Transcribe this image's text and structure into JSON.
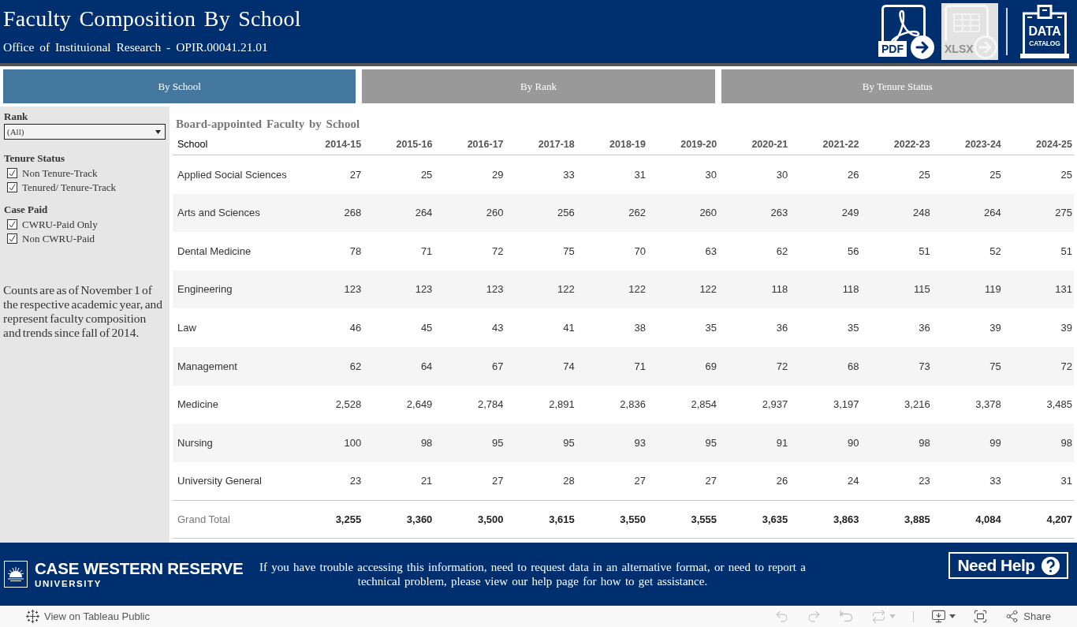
{
  "header": {
    "title": "Faculty Composition By School",
    "subtitle": "Office of Instituional Research - OPIR.00041.21.01",
    "downloads": [
      {
        "kind": "pdf",
        "label": "PDF",
        "disabled": false
      },
      {
        "kind": "xlsx",
        "label": "XLSX",
        "disabled": true
      }
    ],
    "catalog": {
      "label_lines": [
        "DATA",
        "CATALOG"
      ]
    }
  },
  "tabs": [
    {
      "label": "By School",
      "selected": true
    },
    {
      "label": "By Rank",
      "selected": false
    },
    {
      "label": "By Tenure Status",
      "selected": false
    }
  ],
  "filters": {
    "rank": {
      "label": "Rank",
      "value": "(All)"
    },
    "groups": [
      {
        "label": "Tenure Status",
        "options": [
          {
            "label": "Non Tenure-Track",
            "checked": true
          },
          {
            "label": "Tenured/ Tenure-Track",
            "checked": true
          }
        ]
      },
      {
        "label": "Case Paid",
        "options": [
          {
            "label": "CWRU-Paid Only",
            "checked": true
          },
          {
            "label": "Non CWRU-Paid",
            "checked": true
          }
        ]
      }
    ],
    "note": "Counts are as of November 1 of the respective academic year, and represent faculty composition and trends since fall of 2014."
  },
  "table": {
    "title": "Board-appointed Faculty by School",
    "columns": [
      "School",
      "2014-15",
      "2015-16",
      "2016-17",
      "2017-18",
      "2018-19",
      "2019-20",
      "2020-21",
      "2021-22",
      "2022-23",
      "2023-24",
      "2024-25"
    ],
    "rows": [
      {
        "school": "Applied Social Sciences",
        "values": [
          "27",
          "25",
          "29",
          "33",
          "31",
          "30",
          "30",
          "26",
          "25",
          "25",
          "25"
        ]
      },
      {
        "school": "Arts and Sciences",
        "values": [
          "268",
          "264",
          "260",
          "256",
          "262",
          "260",
          "263",
          "249",
          "248",
          "264",
          "275"
        ]
      },
      {
        "school": "Dental Medicine",
        "values": [
          "78",
          "71",
          "72",
          "75",
          "70",
          "63",
          "62",
          "56",
          "51",
          "52",
          "51"
        ]
      },
      {
        "school": "Engineering",
        "values": [
          "123",
          "123",
          "123",
          "122",
          "122",
          "122",
          "118",
          "118",
          "115",
          "119",
          "131"
        ]
      },
      {
        "school": "Law",
        "values": [
          "46",
          "45",
          "43",
          "41",
          "38",
          "35",
          "36",
          "35",
          "36",
          "39",
          "39"
        ]
      },
      {
        "school": "Management",
        "values": [
          "62",
          "64",
          "67",
          "74",
          "71",
          "69",
          "72",
          "68",
          "73",
          "75",
          "72"
        ]
      },
      {
        "school": "Medicine",
        "values": [
          "2,528",
          "2,649",
          "2,784",
          "2,891",
          "2,836",
          "2,854",
          "2,937",
          "3,197",
          "3,216",
          "3,378",
          "3,485"
        ]
      },
      {
        "school": "Nursing",
        "values": [
          "100",
          "98",
          "95",
          "95",
          "93",
          "95",
          "91",
          "90",
          "98",
          "99",
          "98"
        ]
      },
      {
        "school": "University General",
        "values": [
          "23",
          "21",
          "27",
          "28",
          "27",
          "27",
          "26",
          "24",
          "23",
          "33",
          "31"
        ]
      }
    ],
    "total": {
      "label": "Grand Total",
      "values": [
        "3,255",
        "3,360",
        "3,500",
        "3,615",
        "3,550",
        "3,555",
        "3,635",
        "3,863",
        "3,885",
        "4,084",
        "4,207"
      ]
    }
  },
  "footer": {
    "logo": {
      "name": "CASE WESTERN RESERVE",
      "subname": "UNIVERSITY"
    },
    "message": "If you have trouble accessing this information, need to request data in an alternative format, or need to report a technical problem, please view our help page for how to get assistance.",
    "help_button": "Need Help"
  },
  "toolbar": {
    "link": "View on Tableau Public",
    "actions": [
      {
        "kind": "undo",
        "disabled": true,
        "has_menu": false
      },
      {
        "kind": "redo",
        "disabled": true,
        "has_menu": false
      },
      {
        "kind": "revert",
        "disabled": true,
        "has_menu": false
      },
      {
        "kind": "refresh",
        "disabled": true,
        "has_menu": true
      },
      {
        "kind": "download",
        "disabled": false,
        "has_menu": true
      },
      {
        "kind": "fullscreen",
        "disabled": false,
        "has_menu": false
      }
    ],
    "share": "Share"
  }
}
